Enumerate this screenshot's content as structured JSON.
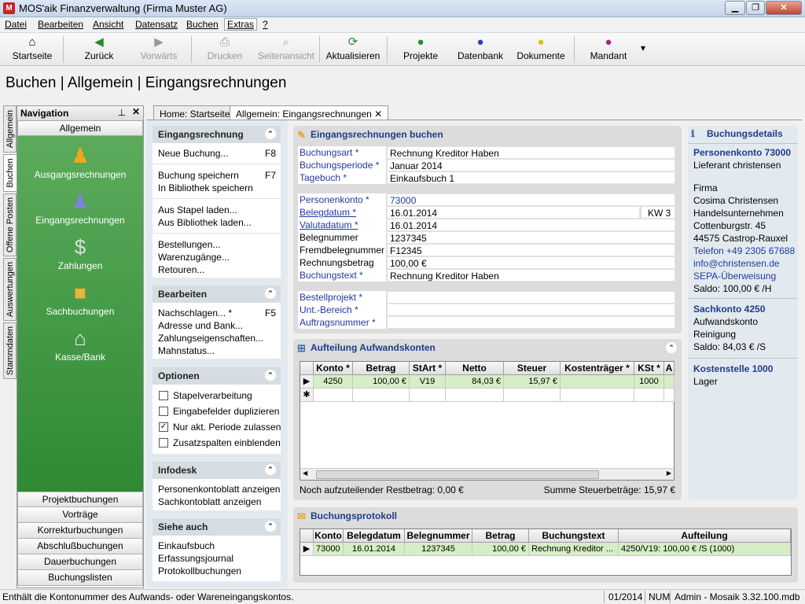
{
  "window": {
    "title": "MOS'aik Finanzverwaltung (Firma Muster AG)",
    "app_icon": "M"
  },
  "menu": [
    "Datei",
    "Bearbeiten",
    "Ansicht",
    "Datensatz",
    "Buchen",
    "Extras",
    "?"
  ],
  "toolbar": {
    "startseite": "Startseite",
    "zurueck": "Zurück",
    "vorwaerts": "Vorwärts",
    "drucken": "Drucken",
    "seitenansicht": "Seitenansicht",
    "aktualisieren": "Aktualisieren",
    "projekte": "Projekte",
    "datenbank": "Datenbank",
    "dokumente": "Dokumente",
    "mandant": "Mandant"
  },
  "page_title": "Buchen | Allgemein | Eingangsrechnungen",
  "vtabs": [
    "Allgemein",
    "Buchen",
    "Offene Posten",
    "Auswertungen",
    "Stammdaten"
  ],
  "nav": {
    "title": "Navigation",
    "group": "Allgemein",
    "items": [
      "Ausgangsrechnungen",
      "Eingangsrechnungen",
      "Zahlungen",
      "Sachbuchungen",
      "Kasse/Bank"
    ],
    "bottom": [
      "Projektbuchungen",
      "Vorträge",
      "Korrekturbuchungen",
      "Abschlußbuchungen",
      "Dauerbuchungen",
      "Buchungslisten"
    ]
  },
  "doctabs": {
    "home": "Home: Startseite",
    "active": "Allgemein: Eingangsrechnungen"
  },
  "tasks": {
    "g1_title": "Eingangsrechnung",
    "neue_buchung": "Neue Buchung...",
    "neue_buchung_key": "F8",
    "buchung_speichern": "Buchung speichern",
    "buchung_speichern_key": "F7",
    "in_bibliothek": "In Bibliothek speichern",
    "aus_stapel": "Aus Stapel laden...",
    "aus_bibliothek": "Aus Bibliothek laden...",
    "bestellungen": "Bestellungen...",
    "warenzugaenge": "Warenzugänge...",
    "retouren": "Retouren...",
    "g2_title": "Bearbeiten",
    "nachschlagen": "Nachschlagen... *",
    "nachschlagen_key": "F5",
    "adresse": "Adresse und Bank...",
    "zahlungseigenschaften": "Zahlungseigenschaften...",
    "mahnstatus": "Mahnstatus...",
    "g3_title": "Optionen",
    "opt1": "Stapelverarbeitung",
    "opt2": "Eingabefelder duplizieren",
    "opt3": "Nur akt. Periode zulassen",
    "opt4": "Zusatzspalten einblenden",
    "g4_title": "Infodesk",
    "info1": "Personenkontoblatt anzeigen",
    "info2": "Sachkontoblatt anzeigen",
    "g5_title": "Siehe auch",
    "see1": "Einkaufsbuch",
    "see2": "Erfassungsjournal",
    "see3": "Protokollbuchungen"
  },
  "form": {
    "title": "Eingangsrechnungen buchen",
    "buchungsart_l": "Buchungsart *",
    "buchungsart": "Rechnung Kreditor Haben",
    "periode_l": "Buchungsperiode *",
    "periode": "Januar 2014",
    "tagebuch_l": "Tagebuch *",
    "tagebuch": "Einkaufsbuch 1",
    "personenkonto_l": "Personenkonto *",
    "personenkonto": "73000",
    "belegdatum_l": "Belegdatum *",
    "belegdatum": "16.01.2014",
    "kw": "KW 3",
    "valutadatum_l": "Valutadatum *",
    "valutadatum": "16.01.2014",
    "belegnummer_l": "Belegnummer",
    "belegnummer": "1237345",
    "fremdbeleg_l": "Fremdbelegnummer",
    "fremdbeleg": "F12345",
    "betrag_l": "Rechnungsbetrag",
    "betrag": "100,00 €",
    "text_l": "Buchungstext *",
    "text": "Rechnung Kreditor Haben",
    "projekt_l": "Bestellprojekt *",
    "bereich_l": "Unt.-Bereich *",
    "auftrag_l": "Auftragsnummer *"
  },
  "aufteilung": {
    "title": "Aufteilung Aufwandskonten",
    "headers": [
      "Konto *",
      "Betrag",
      "StArt *",
      "Netto",
      "Steuer",
      "Kostenträger *",
      "KSt *",
      "A"
    ],
    "row": [
      "4250",
      "100,00 €",
      "V19",
      "84,03 €",
      "15,97 €",
      "",
      "1000"
    ],
    "rest": "Noch aufzuteilender Restbetrag: 0,00 €",
    "summe": "Summe Steuerbeträge: 15,97 €"
  },
  "protokoll": {
    "title": "Buchungsprotokoll",
    "headers": [
      "Konto",
      "Belegdatum",
      "Belegnummer",
      "Betrag",
      "Buchungstext",
      "Aufteilung"
    ],
    "row": [
      "73000",
      "16.01.2014",
      "1237345",
      "100,00 €",
      "Rechnung Kreditor ...",
      "4250/V19: 100,00 € /S (1000)"
    ]
  },
  "details": {
    "title": "Buchungsdetails",
    "pk": "Personenkonto 73000",
    "pk_sub": "Lieferant christensen",
    "firma": "Firma",
    "name": "Cosima Christensen",
    "unternehmen": "Handelsunternehmen",
    "strasse": "Cottenburgstr. 45",
    "ort": "44575 Castrop-Rauxel",
    "telefon": "Telefon +49 2305 67688",
    "email": "info@christensen.de",
    "sepa": "SEPA-Überweisung",
    "saldo1": "Saldo: 100,00 € /H",
    "sk": "Sachkonto 4250",
    "sk_sub1": "Aufwandskonto",
    "sk_sub2": "Reinigung",
    "saldo2": "Saldo: 84,03 € /S",
    "ks": "Kostenstelle 1000",
    "ks_sub": "Lager"
  },
  "status": {
    "text": "Enthält die Kontonummer des Aufwands- oder Wareneingangskontos.",
    "period": "01/2014",
    "num": "NUM",
    "user": "Admin - Mosaik 3.32.100.mdb"
  },
  "colors": {
    "nav_green": "#3f963f",
    "accent_blue": "#1e3c8a",
    "row_select": "#d6edc6"
  }
}
